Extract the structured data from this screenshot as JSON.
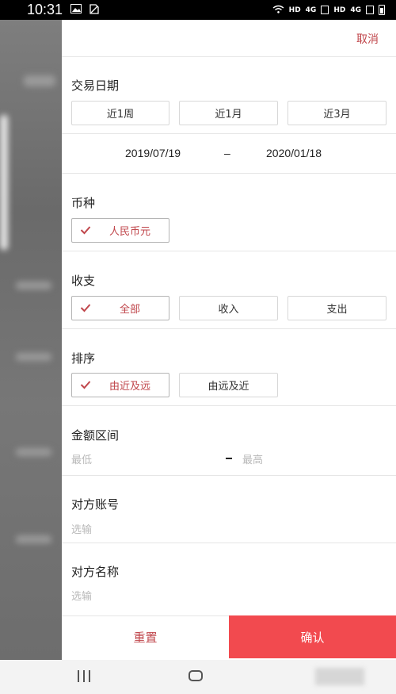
{
  "status_bar": {
    "time": "10:31",
    "net1": "HD",
    "net2": "4G",
    "net3": "HD",
    "net4": "4G"
  },
  "panel": {
    "cancel_label": "取消",
    "trade_date": {
      "title": "交易日期",
      "options": [
        "近1周",
        "近1月",
        "近3月"
      ],
      "start_date": "2019/07/19",
      "separator": "–",
      "end_date": "2020/01/18"
    },
    "currency": {
      "title": "币种",
      "selected": "人民币元"
    },
    "income_expense": {
      "title": "收支",
      "options": [
        "全部",
        "收入",
        "支出"
      ],
      "selected_index": 0
    },
    "sort": {
      "title": "排序",
      "options": [
        "由近及远",
        "由远及近"
      ],
      "selected_index": 0
    },
    "amount_range": {
      "title": "金额区间",
      "min_placeholder": "最低",
      "max_placeholder": "最高"
    },
    "counterparty_account": {
      "title": "对方账号",
      "placeholder": "选输"
    },
    "counterparty_name": {
      "title": "对方名称",
      "placeholder": "选输"
    }
  },
  "footer": {
    "reset_label": "重置",
    "confirm_label": "确认"
  },
  "colors": {
    "accent": "#c0464b",
    "confirm_bg": "#f24a4f"
  }
}
